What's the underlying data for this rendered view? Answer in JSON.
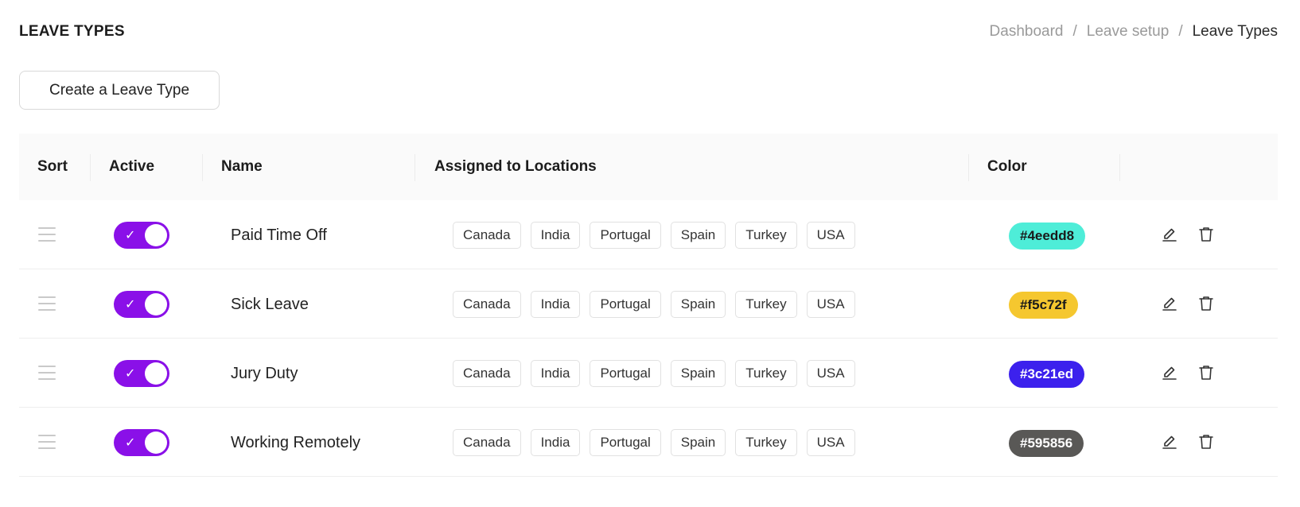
{
  "header": {
    "title": "LEAVE TYPES",
    "breadcrumb": [
      "Dashboard",
      "Leave setup",
      "Leave Types"
    ],
    "separator": "/"
  },
  "create_button": "Create a Leave Type",
  "table": {
    "columns": [
      "Sort",
      "Active",
      "Name",
      "Assigned to Locations",
      "Color"
    ],
    "rows": [
      {
        "active": true,
        "name": "Paid Time Off",
        "locations": [
          "Canada",
          "India",
          "Portugal",
          "Spain",
          "Turkey",
          "USA"
        ],
        "color": "#4eedd8",
        "color_text": "#1a1a1a"
      },
      {
        "active": true,
        "name": "Sick Leave",
        "locations": [
          "Canada",
          "India",
          "Portugal",
          "Spain",
          "Turkey",
          "USA"
        ],
        "color": "#f5c72f",
        "color_text": "#1a1a1a"
      },
      {
        "active": true,
        "name": "Jury Duty",
        "locations": [
          "Canada",
          "India",
          "Portugal",
          "Spain",
          "Turkey",
          "USA"
        ],
        "color": "#3c21ed",
        "color_text": "#ffffff"
      },
      {
        "active": true,
        "name": "Working Remotely",
        "locations": [
          "Canada",
          "India",
          "Portugal",
          "Spain",
          "Turkey",
          "USA"
        ],
        "color": "#595856",
        "color_text": "#ffffff"
      }
    ]
  },
  "icons": {
    "drag": "drag-handle-icon",
    "check": "check-icon",
    "edit": "edit-icon",
    "delete": "trash-icon"
  },
  "accent": "#8a10e8"
}
